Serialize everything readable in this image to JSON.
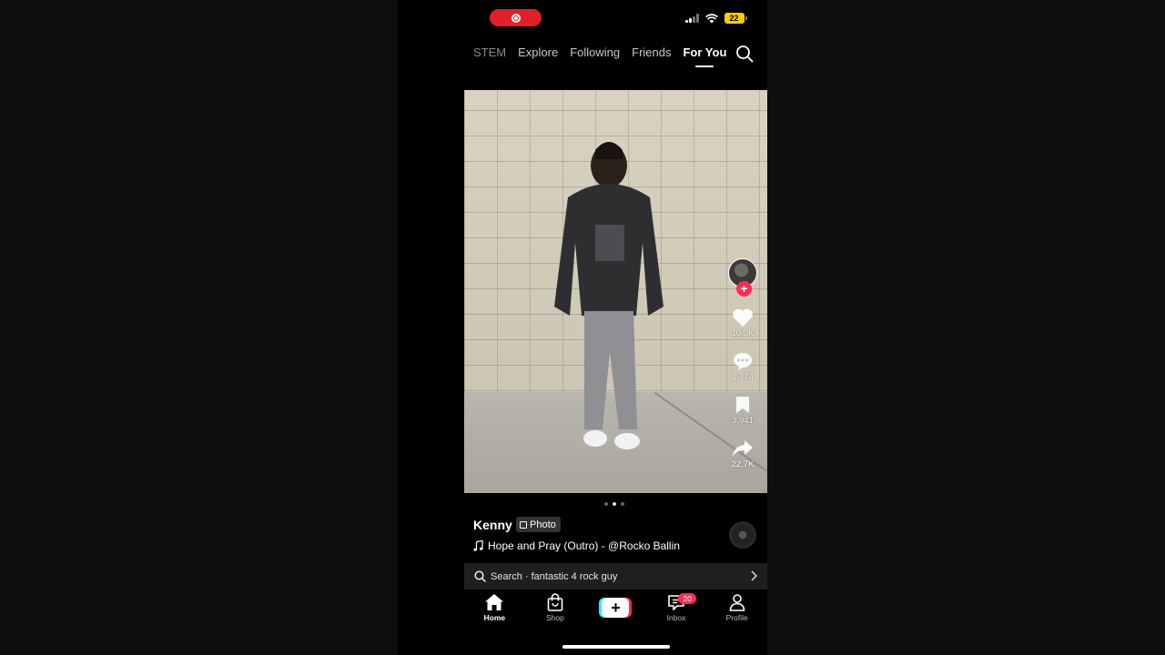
{
  "status_bar": {
    "battery": "22"
  },
  "top_nav": {
    "tabs": [
      {
        "label": "STEM"
      },
      {
        "label": "Explore"
      },
      {
        "label": "Following"
      },
      {
        "label": "Friends"
      },
      {
        "label": "For You"
      }
    ],
    "active_tab": "For You"
  },
  "post": {
    "username": "Kenny",
    "type_badge": "Photo",
    "sound": "Hope and Pray (Outro) - @Rocko Ballin",
    "like_count": "10.0K",
    "comment_count": "2,774",
    "save_count": "3,941",
    "share_count": "22.7K",
    "carousel_current": 2,
    "carousel_total": 3
  },
  "search_bar": {
    "text": "Search · fantastic 4 rock guy"
  },
  "bottom_nav": {
    "items": [
      {
        "label": "Home"
      },
      {
        "label": "Shop"
      },
      {
        "label": ""
      },
      {
        "label": "Inbox",
        "badge": "20"
      },
      {
        "label": "Profile"
      }
    ]
  },
  "colors": {
    "accent": "#fe2c55",
    "cyan": "#25f4ee",
    "record": "#e0202a",
    "battery": "#f5d000"
  }
}
